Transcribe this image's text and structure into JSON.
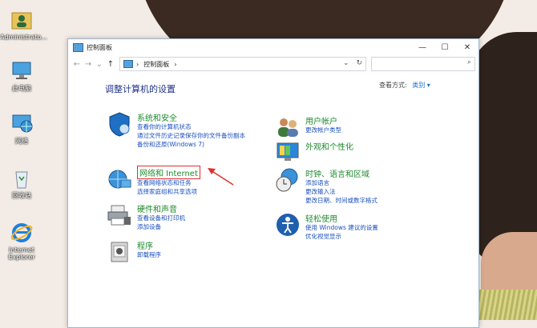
{
  "desktop": {
    "icons": [
      {
        "label": "Administrato...",
        "icon": "user-folder-icon"
      },
      {
        "label": "此电脑",
        "icon": "computer-icon"
      },
      {
        "label": "网络",
        "icon": "network-icon"
      },
      {
        "label": "回收站",
        "icon": "recycle-bin-icon"
      },
      {
        "label": "Internet Explorer",
        "icon": "ie-icon"
      }
    ]
  },
  "window": {
    "title": "控制面板",
    "buttons": {
      "minimize": "—",
      "maximize": "☐",
      "close": "✕"
    },
    "address": {
      "crumb_sep": "›",
      "path": "控制面板",
      "dropdown": "⌄",
      "refresh": "↻"
    },
    "search": {
      "placeholder": "",
      "icon": "⌕"
    },
    "nav": {
      "back": "←",
      "forward": "→",
      "recent": "⌄",
      "up": "↑"
    }
  },
  "content": {
    "heading": "调整计算机的设置",
    "view_by_label": "查看方式:",
    "view_by_value": "类别 ▾",
    "left_categories": [
      {
        "title": "系统和安全",
        "icon": "shield-icon",
        "links": [
          "查看你的计算机状态",
          "通过文件历史记录保存你的文件备份副本",
          "备份和还原(Windows 7)"
        ]
      },
      {
        "title": "网络和 Internet",
        "icon": "network-globe-icon",
        "links": [
          "查看网络状态和任务",
          "选择家庭组和共享选项"
        ]
      },
      {
        "title": "硬件和声音",
        "icon": "printer-icon",
        "links": [
          "查看设备和打印机",
          "添加设备"
        ]
      },
      {
        "title": "程序",
        "icon": "programs-icon",
        "links": [
          "卸载程序"
        ]
      }
    ],
    "right_categories": [
      {
        "title": "用户帐户",
        "icon": "users-icon",
        "links": [
          "更改帐户类型"
        ]
      },
      {
        "title": "外观和个性化",
        "icon": "monitor-icon",
        "links": []
      },
      {
        "title": "时钟、语言和区域",
        "icon": "clock-globe-icon",
        "links": [
          "添加语言",
          "更改输入法",
          "更改日期、时间或数字格式"
        ]
      },
      {
        "title": "轻松使用",
        "icon": "accessibility-icon",
        "links": [
          "使用 Windows 建议的设置",
          "优化视觉显示"
        ]
      }
    ]
  },
  "colors": {
    "link": "#1a4fbf",
    "category_title": "#1e8c2e",
    "heading": "#1e3287",
    "annotation": "#e03030"
  }
}
